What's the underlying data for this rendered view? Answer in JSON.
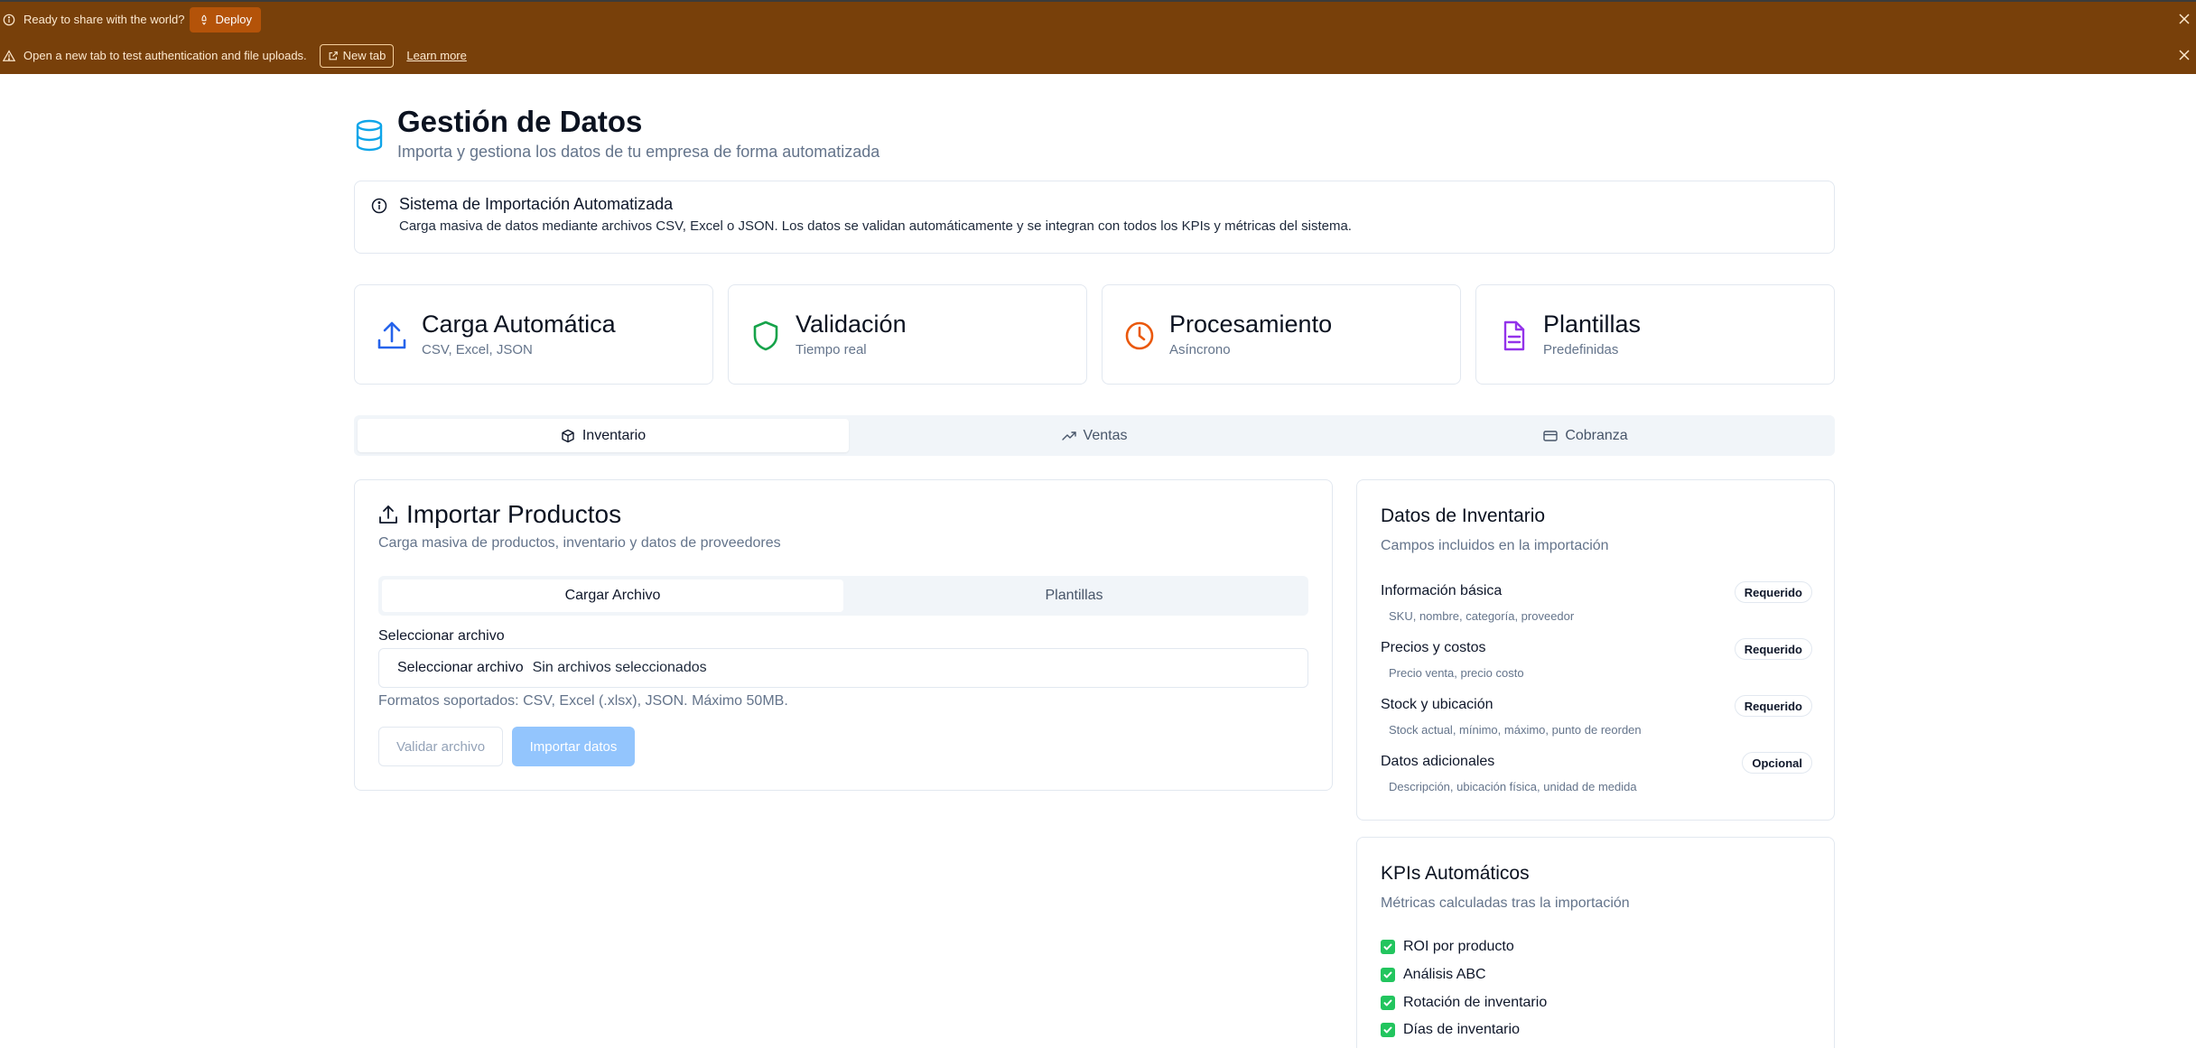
{
  "banner1": {
    "text": "Ready to share with the world?",
    "deploy_label": "Deploy"
  },
  "banner2": {
    "text": "Open a new tab to test authentication and file uploads.",
    "newtab_label": "New tab",
    "learn_label": "Learn more"
  },
  "header": {
    "title": "Gestión de Datos",
    "subtitle": "Importa y gestiona los datos de tu empresa de forma automatizada"
  },
  "alert": {
    "title": "Sistema de Importación Automatizada",
    "description": "Carga masiva de datos mediante archivos CSV, Excel o JSON. Los datos se validan automáticamente y se integran con todos los KPIs y métricas del sistema."
  },
  "features": [
    {
      "title": "Carga Automática",
      "subtitle": "CSV, Excel, JSON",
      "icon": "upload-icon",
      "color": "#2563eb"
    },
    {
      "title": "Validación",
      "subtitle": "Tiempo real",
      "icon": "shield-icon",
      "color": "#16a34a"
    },
    {
      "title": "Procesamiento",
      "subtitle": "Asíncrono",
      "icon": "clock-icon",
      "color": "#ea580c"
    },
    {
      "title": "Plantillas",
      "subtitle": "Predefinidas",
      "icon": "file-text-icon",
      "color": "#9333ea"
    }
  ],
  "tabs": [
    {
      "label": "Inventario",
      "icon": "box-icon",
      "active": true
    },
    {
      "label": "Ventas",
      "icon": "trending-up-icon",
      "active": false
    },
    {
      "label": "Cobranza",
      "icon": "credit-card-icon",
      "active": false
    }
  ],
  "import": {
    "title": "Importar Productos",
    "subtitle": "Carga masiva de productos, inventario y datos de proveedores",
    "subtabs": [
      "Cargar Archivo",
      "Plantillas"
    ],
    "field_label": "Seleccionar archivo",
    "file_button": "Seleccionar archivo",
    "file_none": "Sin archivos seleccionados",
    "formats": "Formatos soportados: CSV, Excel (.xlsx), JSON. Máximo 50MB.",
    "validate_label": "Validar archivo",
    "import_label": "Importar datos"
  },
  "inventory": {
    "title": "Datos de Inventario",
    "subtitle": "Campos incluidos en la importación",
    "rows": [
      {
        "name": "Información básica",
        "desc": "SKU, nombre, categoría, proveedor",
        "badge": "Requerido"
      },
      {
        "name": "Precios y costos",
        "desc": "Precio venta, precio costo",
        "badge": "Requerido"
      },
      {
        "name": "Stock y ubicación",
        "desc": "Stock actual, mínimo, máximo, punto de reorden",
        "badge": "Requerido"
      },
      {
        "name": "Datos adicionales",
        "desc": "Descripción, ubicación física, unidad de medida",
        "badge": "Opcional"
      }
    ]
  },
  "kpis": {
    "title": "KPIs Automáticos",
    "subtitle": "Métricas calculadas tras la importación",
    "items": [
      "ROI por producto",
      "Análisis ABC",
      "Rotación de inventario",
      "Días de inventario"
    ]
  }
}
